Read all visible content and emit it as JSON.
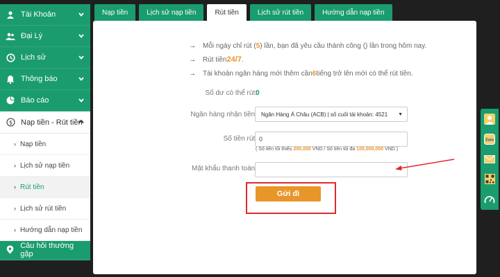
{
  "sidebar": {
    "items": [
      {
        "label": "Tài Khoản",
        "icon": "user-icon"
      },
      {
        "label": "Đại Lý",
        "icon": "users-icon"
      },
      {
        "label": "Lịch sử",
        "icon": "history-icon"
      },
      {
        "label": "Thông báo",
        "icon": "bell-icon"
      },
      {
        "label": "Báo cáo",
        "icon": "pie-chart-icon"
      }
    ],
    "open_item": {
      "label": "Nạp tiền - Rút tiền",
      "icon": "dollar-icon"
    },
    "sub_items": [
      "Nạp tiền",
      "Lịch sử nạp tiền",
      "Rút tiền",
      "Lịch sử rút tiền",
      "Hướng dẫn nạp tiền"
    ],
    "faq": {
      "label": "Câu hỏi thường gặp",
      "icon": "location-pin-icon"
    }
  },
  "tabs": [
    "Nạp tiền",
    "Lịch sử nạp tiền",
    "Rút tiền",
    "Lịch sử rút tiền",
    "Hướng dẫn nạp tiền"
  ],
  "notes": {
    "line1_a": "Mỗi ngày chỉ rút (",
    "line1_num": "5",
    "line1_b": ") lần, bạn đã yêu cầu thành công () lần trong hôm nay.",
    "line2_a": "Rút tiền ",
    "line2_hl": "24/7",
    "line2_b": ".",
    "line3_a": "Tài khoản ngân hàng mới thêm cần ",
    "line3_num": "6",
    "line3_b": " tiếng trở lên mới có thể rút tiền."
  },
  "form": {
    "balance_label": "Số dư có thể rút:",
    "balance_value": "0",
    "bank_label": "Ngân hàng nhận tiền:",
    "bank_value": "Ngân Hàng Á Châu (ACB) | số cuối tài khoản:  4521",
    "amount_label": "Số tiền rút:",
    "amount_value": "0",
    "hint_a": "( Số tiền tối thiểu ",
    "hint_min": "200,000",
    "hint_b": " VND / Số tiền tối đa ",
    "hint_max": "100,000,000",
    "hint_c": " VND )",
    "password_label": "Mật khẩu thanh toán:",
    "submit_label": "Gửi đi"
  },
  "colors": {
    "brand": "#1a9c6e",
    "accent": "#e8952a",
    "annotation": "#e0282c"
  },
  "floatbar": [
    "avatar-icon",
    "zalo-icon",
    "mail-icon",
    "qr-code-icon",
    "speedometer-icon"
  ]
}
